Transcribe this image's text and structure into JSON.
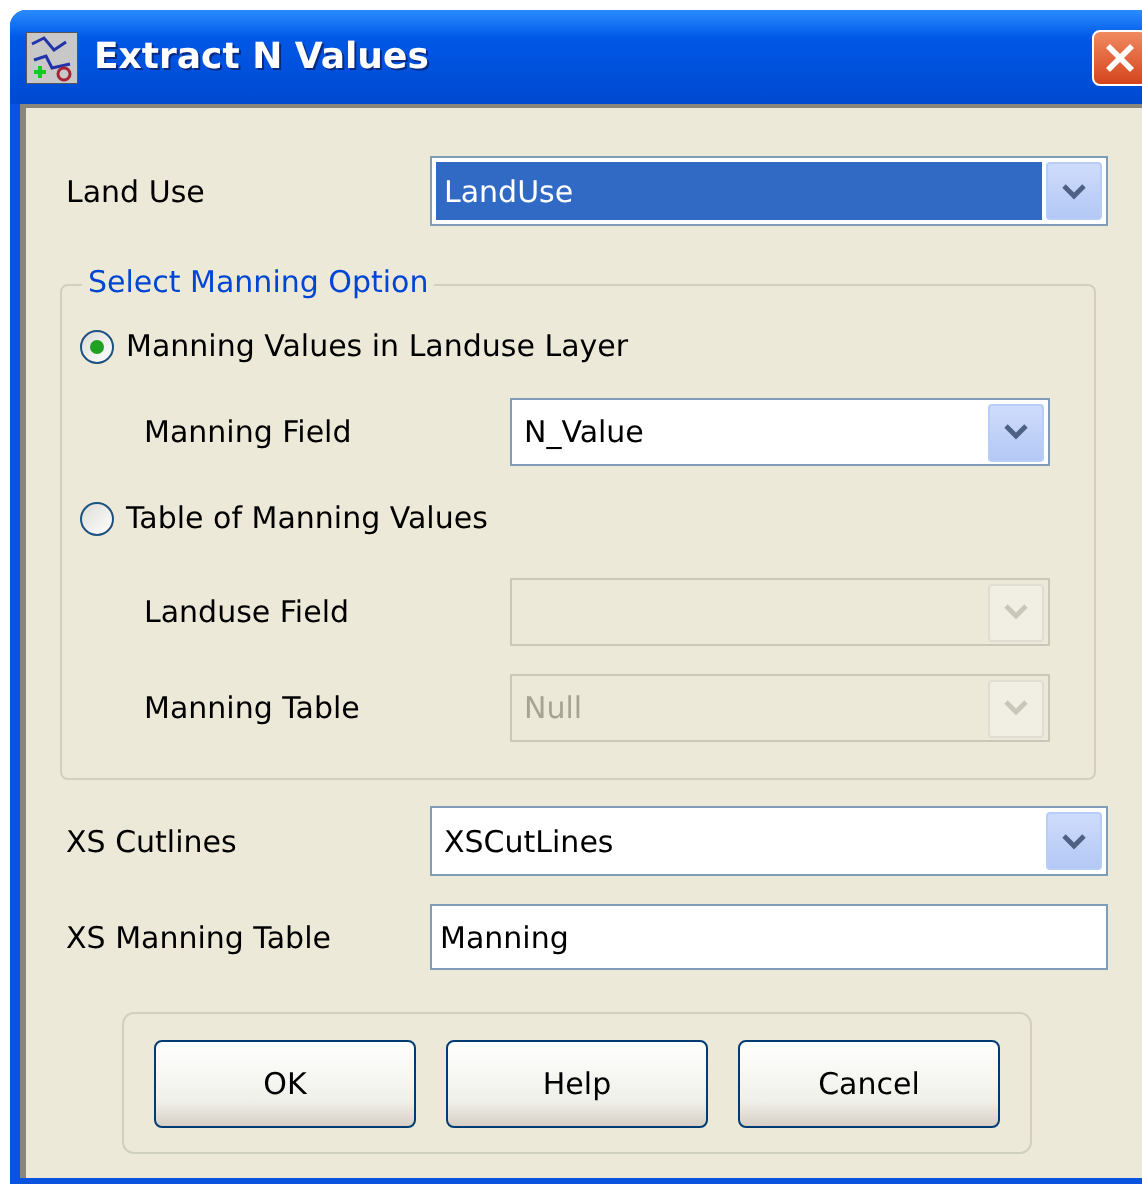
{
  "window": {
    "title": "Extract N Values"
  },
  "land_use": {
    "label": "Land Use",
    "value": "LandUse",
    "focused": true
  },
  "manning_option": {
    "title": "Select Manning Option",
    "options": [
      {
        "label": "Manning Values in Landuse Layer",
        "selected": true,
        "fields": [
          {
            "label": "Manning Field",
            "value": "N_Value",
            "disabled": false
          }
        ]
      },
      {
        "label": "Table of Manning Values",
        "selected": false,
        "fields": [
          {
            "label": "Landuse Field",
            "disabled": true
          },
          {
            "label": "Manning Table",
            "value": "Null",
            "disabled": true
          }
        ]
      }
    ]
  },
  "xs_cutlines": {
    "label": "XS Cutlines",
    "value": "XSCutLines"
  },
  "xs_manning_table": {
    "label": "XS Manning Table",
    "value": "Manning"
  },
  "buttons": [
    "OK",
    "Help",
    "Cancel"
  ]
}
